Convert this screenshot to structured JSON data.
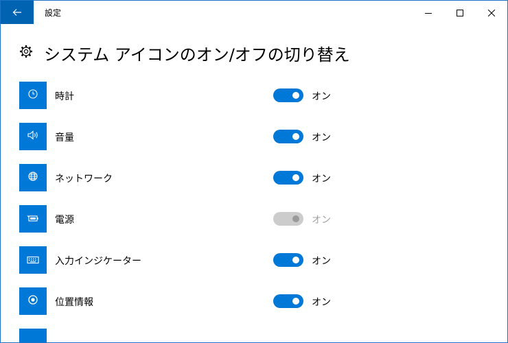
{
  "window": {
    "title": "設定"
  },
  "page": {
    "title": "システム アイコンのオン/オフの切り替え",
    "icon": "gear-icon"
  },
  "colors": {
    "accent": "#0078d7",
    "accent_dark": "#0063b1",
    "disabled": "#cccccc"
  },
  "items": [
    {
      "label": "時計",
      "icon": "clock-icon",
      "state": "オン",
      "on": true,
      "enabled": true
    },
    {
      "label": "音量",
      "icon": "speaker-icon",
      "state": "オン",
      "on": true,
      "enabled": true
    },
    {
      "label": "ネットワーク",
      "icon": "globe-icon",
      "state": "オン",
      "on": true,
      "enabled": true
    },
    {
      "label": "電源",
      "icon": "battery-icon",
      "state": "オン",
      "on": true,
      "enabled": false
    },
    {
      "label": "入力インジケーター",
      "icon": "keyboard-icon",
      "state": "オン",
      "on": true,
      "enabled": true
    },
    {
      "label": "位置情報",
      "icon": "location-icon",
      "state": "オン",
      "on": true,
      "enabled": true
    }
  ]
}
